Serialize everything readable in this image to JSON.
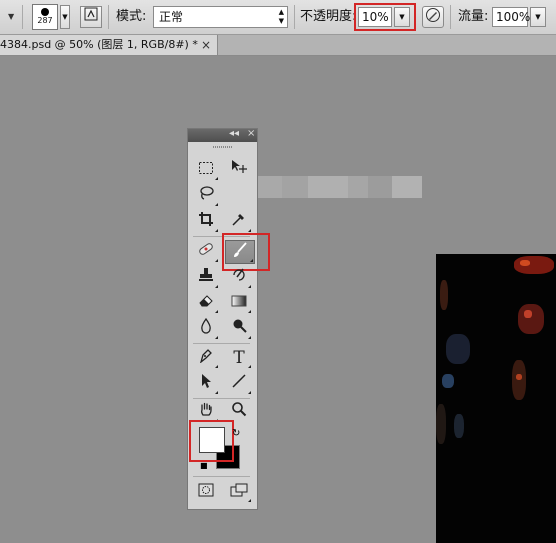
{
  "options_bar": {
    "brush_size": "287",
    "mode_label": "模式:",
    "mode_value": "正常",
    "opacity_label": "不透明度:",
    "opacity_value": "10%",
    "flow_label": "流量:",
    "flow_value": "100%"
  },
  "document_tab": {
    "title": "4384.psd @ 50% (图层 1, RGB/8#) *",
    "close_label": "×"
  },
  "toolbox": {
    "collapse_label": "◂◂",
    "close_label": "×",
    "type_tool_label": "T"
  },
  "colors": {
    "foreground": "#ffffff",
    "background": "#000000",
    "highlight": "#d32626"
  }
}
